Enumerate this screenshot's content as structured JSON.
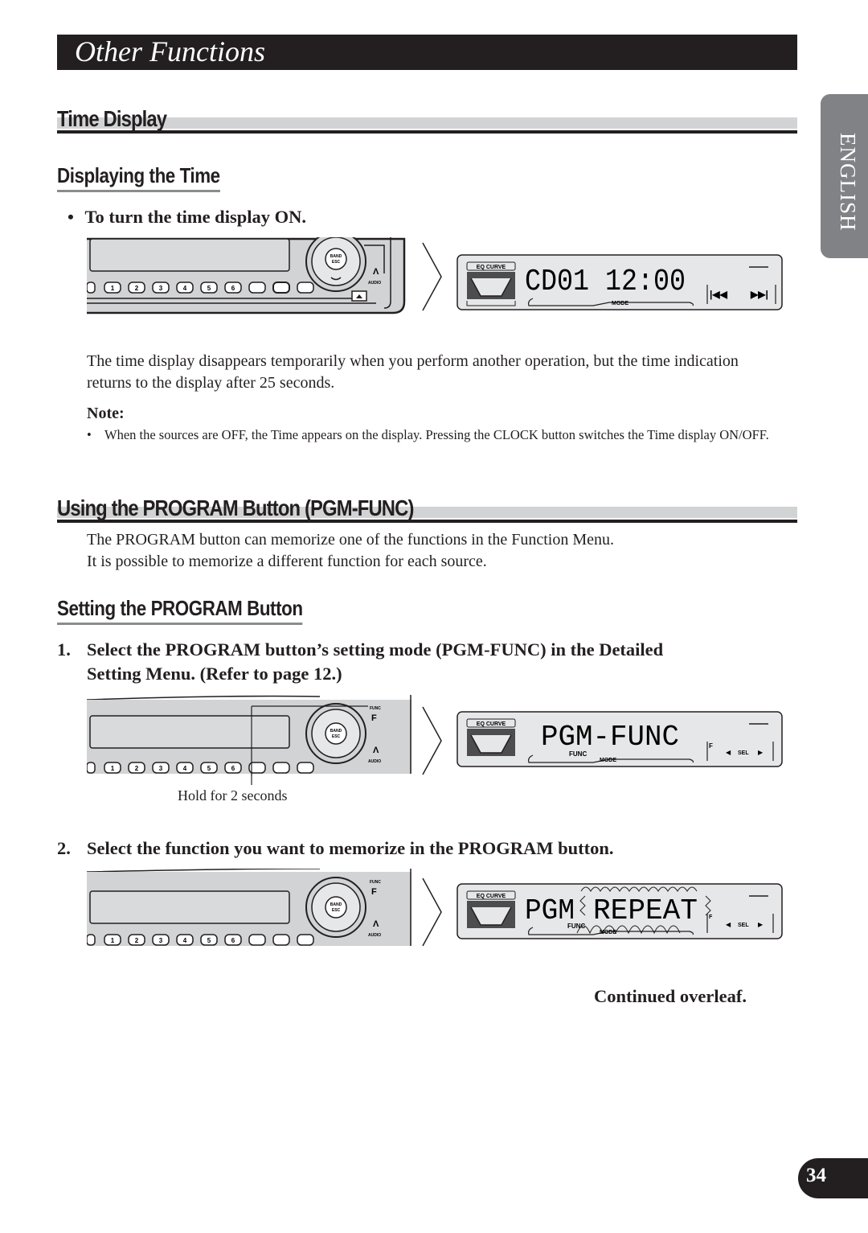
{
  "page": {
    "title": "Other Functions",
    "language_tab": "ENGLISH",
    "page_number": "34"
  },
  "section1": {
    "heading": "Time Display",
    "subheading": "Displaying the Time",
    "bullet": "•",
    "instruction": "To turn the time display ON.",
    "lcd": {
      "eq_label": "EQ CURVE",
      "main_text": "CD01  12:00",
      "mode_label": "MODE",
      "prev_icon": "|◀◀",
      "next_icon": "▶▶|"
    },
    "body": "The time display disappears temporarily when you perform another operation, but the time indication returns to the display after 25 seconds.",
    "note_label": "Note:",
    "note_bullet": "•",
    "note_text": "When the sources are OFF, the Time appears on the display. Pressing the CLOCK button switches the Time display ON/OFF."
  },
  "section2": {
    "heading": "Using the PROGRAM Button (PGM-FUNC)",
    "intro_line1": "The PROGRAM button can memorize one of the functions in the Function Menu.",
    "intro_line2": "It is possible to memorize a different function for each source.",
    "subheading": "Setting the PROGRAM Button",
    "steps": [
      {
        "number": "1.",
        "line1": "Select the PROGRAM button’s setting mode (PGM-FUNC) in the Detailed",
        "line2": "Setting Menu. (Refer to page 12.)",
        "callout": "Hold for 2 seconds",
        "lcd": {
          "eq_label": "EQ CURVE",
          "main_text": "PGM-FUNC",
          "func_label": "FUNC",
          "mode_label": "MODE",
          "f_label": "F",
          "sel_label": "SEL"
        }
      },
      {
        "number": "2.",
        "line1": "Select the function you want to memorize in the PROGRAM button.",
        "lcd": {
          "eq_label": "EQ CURVE",
          "main_text_prefix": "PGM",
          "main_text_flash": "REPEAT",
          "func_label": "FUNC",
          "mode_label": "MODE",
          "f_label": "F",
          "sel_label": "SEL"
        }
      }
    ],
    "continued": "Continued overleaf."
  },
  "head_unit": {
    "preset_buttons": [
      "1",
      "2",
      "3",
      "4",
      "5",
      "6"
    ],
    "band_label": "BAND",
    "esc_label": "ESC",
    "func_label": "FUNC",
    "f_label": "F",
    "audio_label": "AUDIO",
    "audio_symbol": "Λ"
  }
}
